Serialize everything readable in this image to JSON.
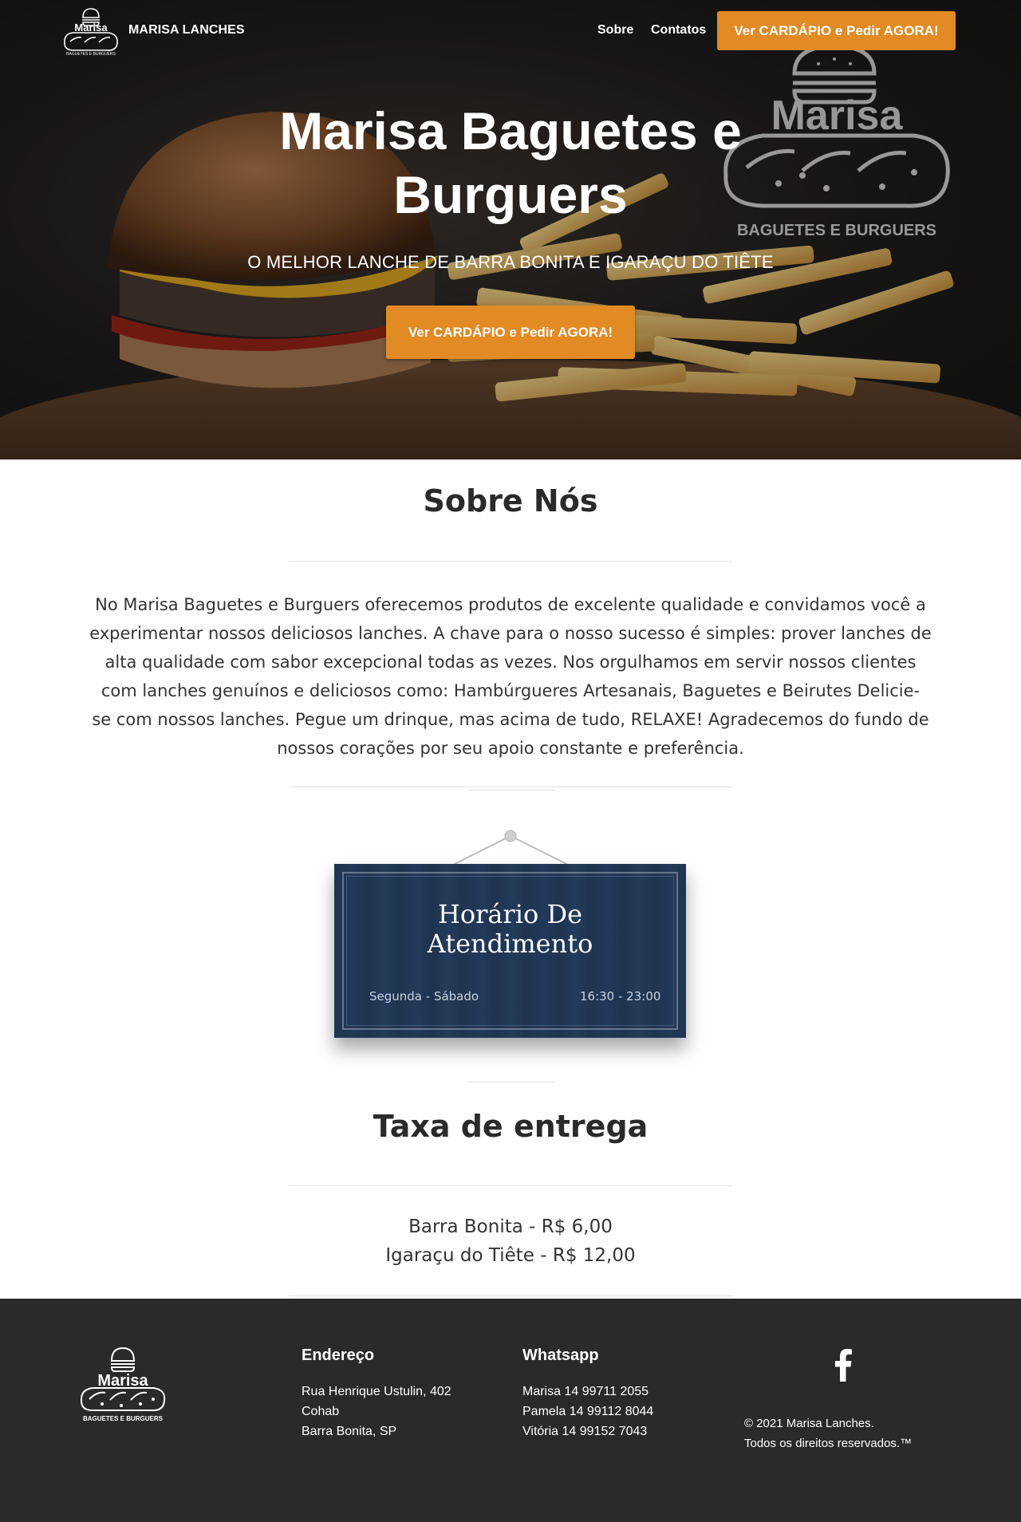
{
  "nav": {
    "brand": "MARISA LANCHES",
    "links": [
      "Sobre",
      "Contatos"
    ],
    "cta": "Ver CARDÁPIO e Pedir AGORA!"
  },
  "hero": {
    "title_line1": "Marisa Baguetes e",
    "title_line2": "Burguers",
    "subtitle": "O MELHOR LANCHE DE BARRA BONITA E IGARAÇU DO TIÊTE",
    "cta": "Ver CARDÁPIO e Pedir AGORA!",
    "watermark_name": "Marisa",
    "watermark_tagline": "BAGUETES E BURGUERS"
  },
  "logo": {
    "name": "Marisa",
    "tagline": "BAGUETES E BURGUERS"
  },
  "about": {
    "title": "Sobre Nós",
    "lines": [
      "No Marisa Baguetes e Burguers oferecemos produtos de excelente qualidade e convidamos você a",
      "experimentar nossos deliciosos lanches. A chave para o nosso sucesso é simples: prover lanches de",
      "alta qualidade com sabor excepcional todas as vezes. Nos orgulhamos em servir nossos clientes",
      "com lanches genuínos e deliciosos como: Hambúrgueres Artesanais, Baguetes e Beirutes Delicie-",
      "se com nossos lanches. Pegue um drinque, mas acima de tudo, RELAXE! Agradecemos do fundo de",
      "nossos corações por seu apoio constante e preferência."
    ]
  },
  "hours": {
    "title_line1": "Horário De",
    "title_line2": "Atendimento",
    "days": "Segunda - Sábado",
    "time": "16:30 - 23:00"
  },
  "delivery": {
    "title": "Taxa de entrega",
    "items": [
      "Barra Bonita - R$ 6,00",
      "Igaraçu do Tiête - R$ 12,00"
    ]
  },
  "footer": {
    "address_title": "Endereço",
    "address_lines": [
      "Rua Henrique Ustulin, 402",
      "Cohab",
      "Barra Bonita, SP"
    ],
    "whatsapp_title": "Whatsapp",
    "whatsapp_lines": [
      "Marisa 14 99711 2055",
      "Pamela 14 99112 8044",
      "Vitória 14 99152 7043"
    ],
    "copyright_lines": [
      "© 2021 Marisa Lanches.",
      "Todos os direitos reservados.™"
    ],
    "social_icon": "facebook-icon"
  },
  "colors": {
    "accent": "#e28a24",
    "footer_bg": "#2a2a2a",
    "sign_bg": "#1f3450"
  }
}
